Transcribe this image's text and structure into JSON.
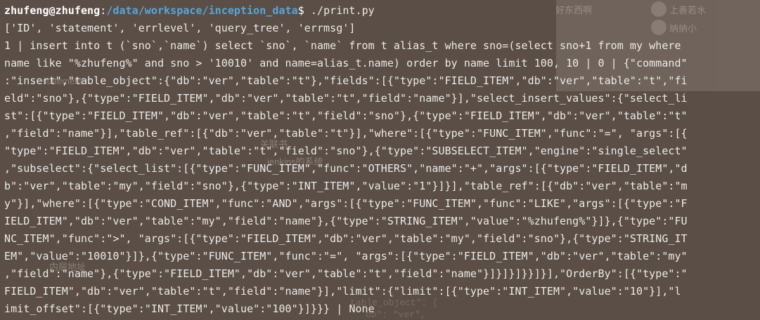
{
  "background_window": {
    "labels": [
      "好东西啊",
      "上善若水",
      "纳纳小",
      "statement",
      "关联书",
      "jenkins的系统",
      "内层地址"
    ],
    "code_fragments": [
      "table_object\": {",
      "db\": \"ver\","
    ]
  },
  "terminal": {
    "prompt": {
      "user_host": "zhufeng@zhufeng",
      "separator": ":",
      "path": "/data/workspace/inception_data",
      "symbol": "$ ",
      "command": "./print.py"
    },
    "output_lines": [
      "['ID', 'statement', 'errlevel', 'query_tree', 'errmsg']",
      "1 | insert into t (`sno`,`name`) select `sno`, `name` from t alias_t where sno=(select sno+1 from my where",
      "name like \"%zhufeng%\" and sno > '10010' and name=alias_t.name) order by name limit 100, 10 | 0 | {\"command\"",
      ":\"insert\",\"table_object\":{\"db\":\"ver\",\"table\":\"t\"},\"fields\":[{\"type\":\"FIELD_ITEM\",\"db\":\"ver\",\"table\":\"t\",\"fi",
      "eld\":\"sno\"},{\"type\":\"FIELD_ITEM\",\"db\":\"ver\",\"table\":\"t\",\"field\":\"name\"}],\"select_insert_values\":{\"select_li",
      "st\":[{\"type\":\"FIELD_ITEM\",\"db\":\"ver\",\"table\":\"t\",\"field\":\"sno\"},{\"type\":\"FIELD_ITEM\",\"db\":\"ver\",\"table\":\"t\"",
      ",\"field\":\"name\"}],\"table_ref\":[{\"db\":\"ver\",\"table\":\"t\"}],\"where\":[{\"type\":\"FUNC_ITEM\",\"func\":\"=\", \"args\":[{",
      "\"type\":\"FIELD_ITEM\",\"db\":\"ver\",\"table\":\"t\",\"field\":\"sno\"},{\"type\":\"SUBSELECT_ITEM\",\"engine\":\"single_select\"",
      ",\"subselect\":{\"select_list\":[{\"type\":\"FUNC_ITEM\",\"func\":\"OTHERS\",\"name\":\"+\",\"args\":[{\"type\":\"FIELD_ITEM\",\"d",
      "b\":\"ver\",\"table\":\"my\",\"field\":\"sno\"},{\"type\":\"INT_ITEM\",\"value\":\"1\"}]}],\"table_ref\":[{\"db\":\"ver\",\"table\":\"m",
      "y\"}],\"where\":[{\"type\":\"COND_ITEM\",\"func\":\"AND\",\"args\":[{\"type\":\"FUNC_ITEM\",\"func\":\"LIKE\",\"args\":[{\"type\":\"F",
      "IELD_ITEM\",\"db\":\"ver\",\"table\":\"my\",\"field\":\"name\"},{\"type\":\"STRING_ITEM\",\"value\":\"%zhufeng%\"}]},{\"type\":\"FU",
      "NC_ITEM\",\"func\":\">\", \"args\":[{\"type\":\"FIELD_ITEM\",\"db\":\"ver\",\"table\":\"my\",\"field\":\"sno\"},{\"type\":\"STRING_IT",
      "EM\",\"value\":\"10010\"}]},{\"type\":\"FUNC_ITEM\",\"func\":\"=\", \"args\":[{\"type\":\"FIELD_ITEM\",\"db\":\"ver\",\"table\":\"my\"",
      ",\"field\":\"name\"},{\"type\":\"FIELD_ITEM\",\"db\":\"ver\",\"table\":\"t\",\"field\":\"name\"}]}]}]}}]}],\"OrderBy\":[{\"type\":\"",
      "FIELD_ITEM\",\"db\":\"ver\",\"table\":\"t\",\"field\":\"name\"}],\"limit\":{\"limit\":[{\"type\":\"INT_ITEM\",\"value\":\"10\"}],\"l",
      "imit_offset\":[{\"type\":\"INT_ITEM\",\"value\":\"100\"}]}}} | None"
    ]
  },
  "colors": {
    "background": "#5a4e47",
    "text": "#ecebe8",
    "path": "#58a6d6"
  }
}
